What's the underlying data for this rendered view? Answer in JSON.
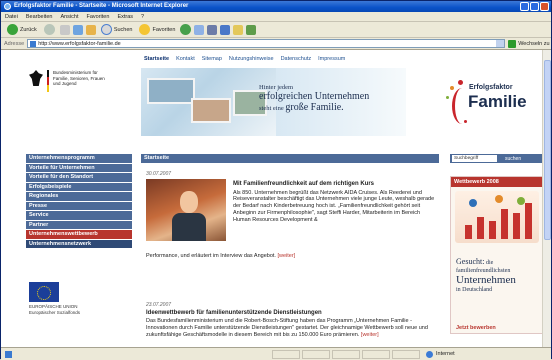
{
  "browser": {
    "title": "Erfolgsfaktor Familie - Startseite - Microsoft Internet Explorer",
    "menu": [
      "Datei",
      "Bearbeiten",
      "Ansicht",
      "Favoriten",
      "Extras",
      "?"
    ],
    "toolbar": {
      "back": "Zurück",
      "search": "Suchen",
      "favorites": "Favoriten"
    },
    "address_label": "Adresse",
    "address_value": "http://www.erfolgsfaktor-familie.de",
    "go_label": "Wechseln zu",
    "status_zone": "Internet"
  },
  "page": {
    "topnav": [
      "Startseite",
      "Kontakt",
      "Sitemap",
      "Nutzungshinweise",
      "Datenschutz",
      "Impressum"
    ],
    "ministry": "Bundesministerium für Familie, Senioren, Frauen und Jugend",
    "banner": {
      "slogan_1": "Hinter jedem",
      "slogan_2": "erfolgreichen Unternehmen",
      "slogan_3a": "steht eine",
      "slogan_3b": "große Familie.",
      "logo_top": "Erfolgsfaktor",
      "logo_main": "Familie"
    },
    "sidenav": [
      "Unternehmensprogramm",
      "Vorteile für Unternehmen",
      "Vorteile für den Standort",
      "Erfolgsbeispiele",
      "Regionales",
      "Presse",
      "Service",
      "Partner",
      "Unternehmenswettbewerb",
      "Unternehmensnetzwerk"
    ],
    "eu_text": "EUROPÄISCHE UNION Europäischer Sozialfonds",
    "main_header": "Startseite",
    "article1": {
      "date": "30.07.2007",
      "title": "Mit Familienfreundlichkeit auf dem richtigen Kurs",
      "text": "Als 850. Unternehmen begrüßt das Netzwerk AIDA Cruises. Als Reederei und Reiseveranstalter beschäftigt das Unternehmen viele junge Leute, weshalb gerade der Bedarf nach Kinderbetreuung hoch ist. „Familienfreundlichkeit gehört seit Anbeginn zur Firmenphilosophie\", sagt Steffi Harder, Mitarbeiterin im Bereich Human Resources Development &",
      "text_cont": "Performance, und erläutert im Interview das Angebot.",
      "more": "[weiter]"
    },
    "article2": {
      "date": "23.07.2007",
      "title": "Ideenwettbewerb für familienunterstützende Dienstleistungen",
      "text": "Das Bundesfamilienministerium und die Robert-Bosch-Stiftung haben das Programm „Unternehmen Familie - Innovationen durch Familie unterstützende Dienstleistungen\" gestartet. Der gleichnamige Wettbewerb soll neue und zukunftsfähige Geschäftsmodelle in diesem Bereich mit bis zu 150.000 Euro prämieren.",
      "more": "[weiter]"
    },
    "search": {
      "value": "Suchbegriff",
      "button": "suchen"
    },
    "wettbewerb": {
      "header": "Wettbewerb 2008",
      "t1": "Gesucht:",
      "t1b": "die",
      "t2": "familienfreundlichsten",
      "t3": "Unternehmen",
      "t4": "in Deutschland",
      "link": "Jetzt bewerben"
    }
  },
  "colors": {
    "nav_blue": "#4c6a98",
    "accent_red": "#b8352e",
    "ie_blue": "#0a52c8"
  }
}
